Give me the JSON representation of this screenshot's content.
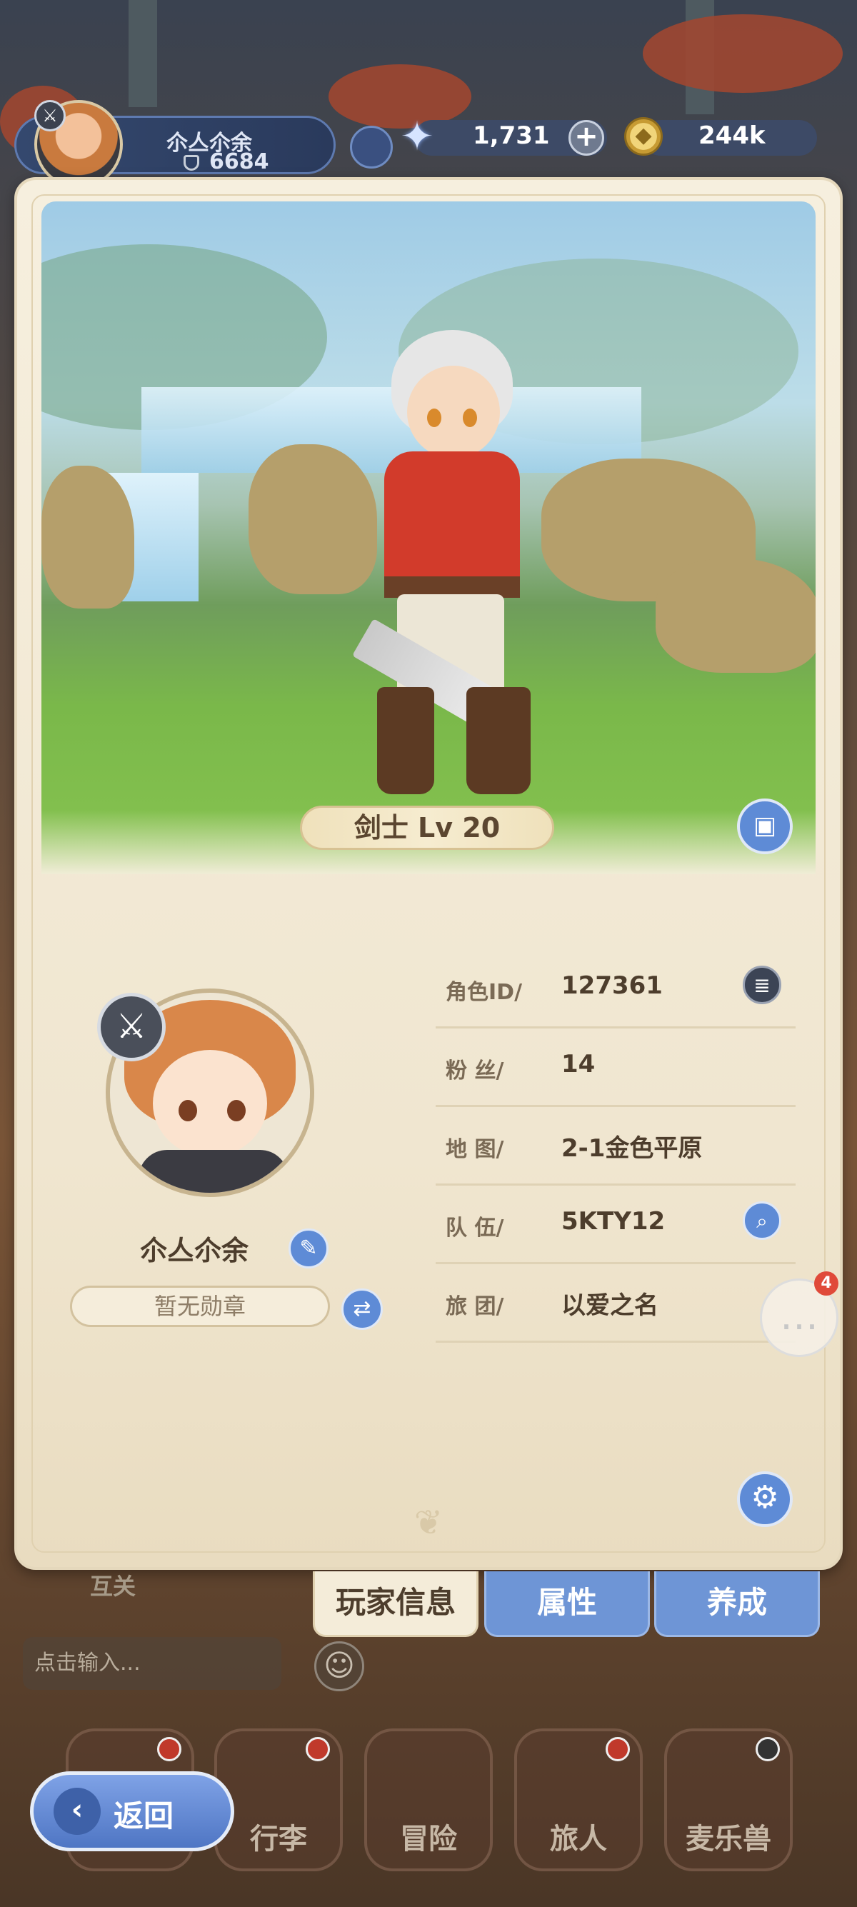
{
  "topbar": {
    "player_name": "尒亼尒余",
    "power": "6684",
    "star_currency": "1,731",
    "gold_currency": "244k"
  },
  "hero": {
    "class_level": "剑士 Lv 20"
  },
  "profile": {
    "name": "尒亼尒余",
    "medal": "暂无勋章"
  },
  "info": [
    {
      "label": "角色ID/",
      "value": "127361"
    },
    {
      "label": "粉    丝/",
      "value": "14"
    },
    {
      "label": "地    图/",
      "value": "2-1金色平原"
    },
    {
      "label": "队    伍/",
      "value": "5KTY12"
    },
    {
      "label": "旅    团/",
      "value": "以爱之名"
    }
  ],
  "chat": {
    "unread": "4",
    "input_placeholder": "点击输入...",
    "partial_text": "互关"
  },
  "tabs": [
    {
      "label": "玩家信息",
      "active": true
    },
    {
      "label": "属性",
      "active": false
    },
    {
      "label": "养成",
      "active": false
    }
  ],
  "bottom_nav": [
    {
      "label": "",
      "icon": "castle-icon"
    },
    {
      "label": "行李",
      "icon": "bag-icon"
    },
    {
      "label": "冒险",
      "icon": "crossed-swords-icon"
    },
    {
      "label": "旅人",
      "icon": "traveler-icon"
    },
    {
      "label": "麦乐兽",
      "icon": "pet-icon"
    }
  ],
  "back_button": {
    "label": "返回"
  },
  "colors": {
    "accent_blue": "#5e8bd6",
    "card_bg": "#f6efde",
    "text_dark": "#4d3d2c",
    "badge_red": "#e04a3a"
  }
}
